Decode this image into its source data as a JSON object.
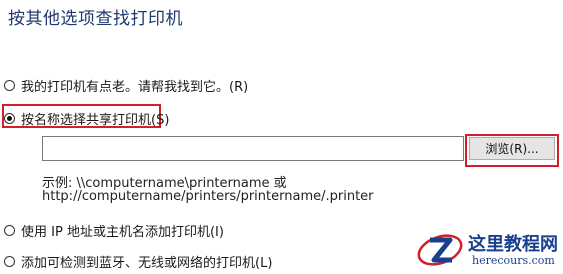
{
  "heading": "按其他选项查找打印机",
  "options": [
    {
      "label": "我的打印机有点老。请帮我找到它。(R)",
      "checked": false
    },
    {
      "label": "按名称选择共享打印机(S)",
      "checked": true
    },
    {
      "label": "使用 IP 地址或主机名添加打印机(I)",
      "checked": false
    },
    {
      "label": "添加可检测到蓝牙、无线或网络的打印机(L)",
      "checked": false
    }
  ],
  "printer_name": {
    "value": ""
  },
  "browse_label": "浏览(R)...",
  "example": {
    "line1": "示例: \\\\computername\\printername 或",
    "line2": "http://computername/printers/printername/.printer"
  },
  "watermark": {
    "title": "这里教程网",
    "url": "herecours.com"
  },
  "colors": {
    "highlight": "#d2202a",
    "heading": "#1e3a6e",
    "watermark": "#1a3f8c"
  }
}
